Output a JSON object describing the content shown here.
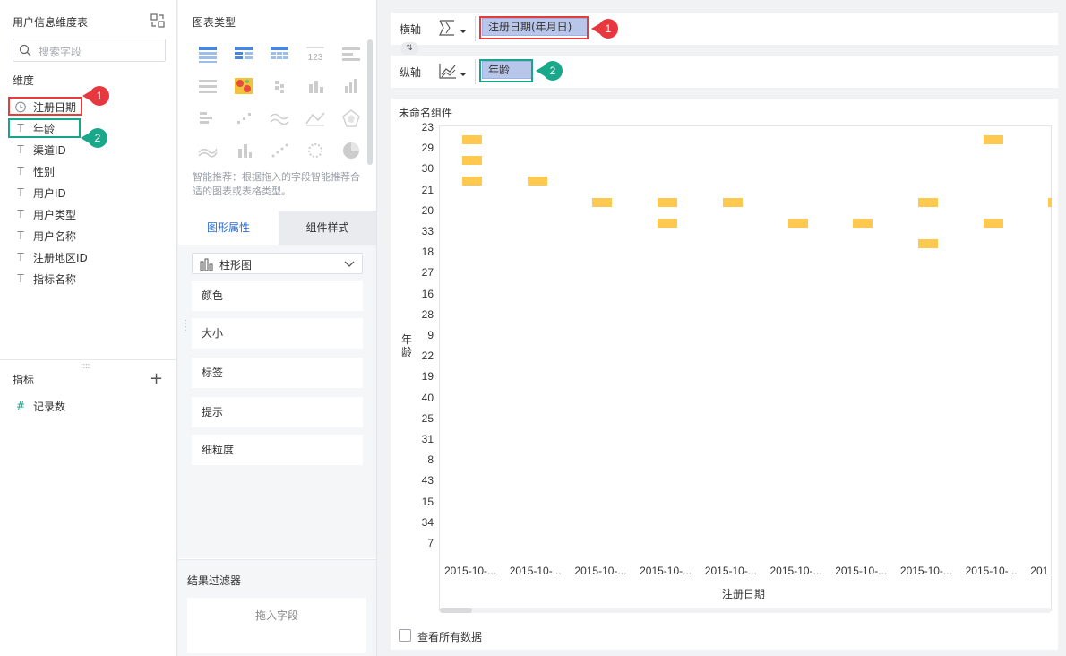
{
  "left_panel": {
    "title": "用户信息维度表",
    "search_placeholder": "搜索字段",
    "dimension_label": "维度",
    "dimensions": [
      {
        "label": "注册日期",
        "icon": "clock-icon"
      },
      {
        "label": "年龄",
        "icon": "text-type-icon"
      },
      {
        "label": "渠道ID",
        "icon": "text-type-icon"
      },
      {
        "label": "性别",
        "icon": "text-type-icon"
      },
      {
        "label": "用户ID",
        "icon": "text-type-icon"
      },
      {
        "label": "用户类型",
        "icon": "text-type-icon"
      },
      {
        "label": "用户名称",
        "icon": "text-type-icon"
      },
      {
        "label": "注册地区ID",
        "icon": "text-type-icon"
      },
      {
        "label": "指标名称",
        "icon": "text-type-icon"
      }
    ],
    "metric_label": "指标",
    "metrics": [
      {
        "label": "记录数",
        "icon": "number-type-icon"
      }
    ]
  },
  "middle_panel": {
    "title": "图表类型",
    "smart_tip": "智能推荐：根据拖入的字段智能推荐合适的图表或表格类型。",
    "tabs": [
      {
        "label": "图形属性"
      },
      {
        "label": "组件样式"
      }
    ],
    "chart_type_select": "柱形图",
    "properties": [
      "颜色",
      "大小",
      "标签",
      "提示",
      "细粒度"
    ],
    "filter_label": "结果过滤器",
    "drop_placeholder": "拖入字段"
  },
  "annotations": {
    "marker_1": "1",
    "marker_2": "2"
  },
  "axes": {
    "x_label": "横轴",
    "x_field": "注册日期(年月日)",
    "y_label": "纵轴",
    "y_field": "年龄"
  },
  "chart_card": {
    "name": "未命名组件",
    "view_all_label": "查看所有数据"
  },
  "chart_data": {
    "type": "bar",
    "xlabel": "注册日期",
    "ylabel": "年龄",
    "y_categories": [
      "23",
      "29",
      "30",
      "21",
      "20",
      "33",
      "18",
      "27",
      "16",
      "28",
      "9",
      "22",
      "19",
      "40",
      "25",
      "31",
      "8",
      "43",
      "15",
      "34",
      "7"
    ],
    "x_tick_labels": [
      "2015-10-...",
      "2015-10-...",
      "2015-10-...",
      "2015-10-...",
      "2015-10-...",
      "2015-10-...",
      "2015-10-...",
      "2015-10-...",
      "2015-10-...",
      "201"
    ],
    "cells": [
      {
        "x": 0,
        "y": "23"
      },
      {
        "x": 0,
        "y": "29"
      },
      {
        "x": 0,
        "y": "30"
      },
      {
        "x": 1,
        "y": "30"
      },
      {
        "x": 2,
        "y": "21"
      },
      {
        "x": 3,
        "y": "21"
      },
      {
        "x": 3,
        "y": "20"
      },
      {
        "x": 4,
        "y": "21"
      },
      {
        "x": 5,
        "y": "20"
      },
      {
        "x": 6,
        "y": "20"
      },
      {
        "x": 7,
        "y": "21"
      },
      {
        "x": 7,
        "y": "33"
      },
      {
        "x": 8,
        "y": "23"
      },
      {
        "x": 8,
        "y": "20"
      },
      {
        "x": 9,
        "y": "21"
      }
    ],
    "bar_color": "#ffc94f"
  },
  "colors": {
    "accent": "#2b6fd6",
    "highlight_red": "#e63c3c",
    "highlight_green": "#19a58a"
  }
}
